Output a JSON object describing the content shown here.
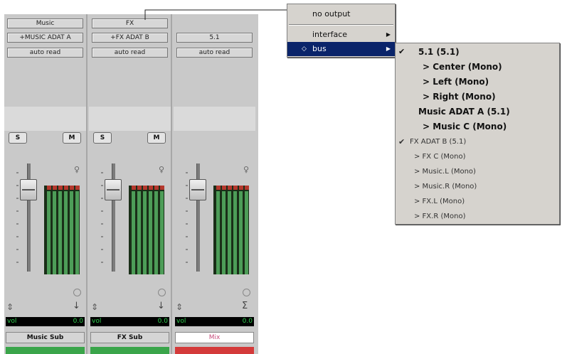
{
  "strips": [
    {
      "name_button": "Music",
      "io_button": "+MUSIC ADAT A",
      "automation": "auto read",
      "solo": "S",
      "mute": "M",
      "vol_label": "vol",
      "vol_value": "0.0",
      "track_name": "Music Sub",
      "color": "#3aa54a"
    },
    {
      "name_button": "FX",
      "io_button": "+FX ADAT B",
      "automation": "auto read",
      "solo": "S",
      "mute": "M",
      "vol_label": "vol",
      "vol_value": "0.0",
      "track_name": "FX Sub",
      "color": "#3aa54a"
    },
    {
      "name_button": "",
      "io_button": "5.1",
      "automation": "auto read",
      "solo": "",
      "mute": "",
      "vol_label": "vol",
      "vol_value": "0.0",
      "track_name": "Mix",
      "color": "#d43a3a"
    }
  ],
  "output_menu": {
    "items": [
      {
        "label": "no output",
        "arrow": ""
      },
      {
        "label": "interface",
        "arrow": "▶"
      },
      {
        "label": "bus",
        "arrow": "▶",
        "marker": "◇"
      }
    ]
  },
  "bus_submenu": {
    "items": [
      {
        "label": "5.1 (5.1)",
        "check": "✔"
      },
      {
        "label": "> Center (Mono)",
        "check": ""
      },
      {
        "label": "> Left (Mono)",
        "check": ""
      },
      {
        "label": "> Right (Mono)",
        "check": ""
      },
      {
        "label": "Music ADAT A (5.1)",
        "check": ""
      },
      {
        "label": "> Music C (Mono)",
        "check": ""
      },
      {
        "label": "FX ADAT B (5.1)",
        "check": "✔"
      },
      {
        "label": "> FX C (Mono)",
        "check": ""
      },
      {
        "label": "> Music.L (Mono)",
        "check": ""
      },
      {
        "label": "> Music.R (Mono)",
        "check": ""
      },
      {
        "label": "> FX.L (Mono)",
        "check": ""
      },
      {
        "label": "> FX.R (Mono)",
        "check": ""
      }
    ]
  },
  "icons": {
    "volume_updown": "updown-arrow-icon",
    "output_down": "down-arrow-icon",
    "sum": "sigma-icon"
  },
  "colors": {
    "menu_highlight": "#0a246a",
    "meter_green": "#4d9d58",
    "meter_red": "#b4382d"
  }
}
